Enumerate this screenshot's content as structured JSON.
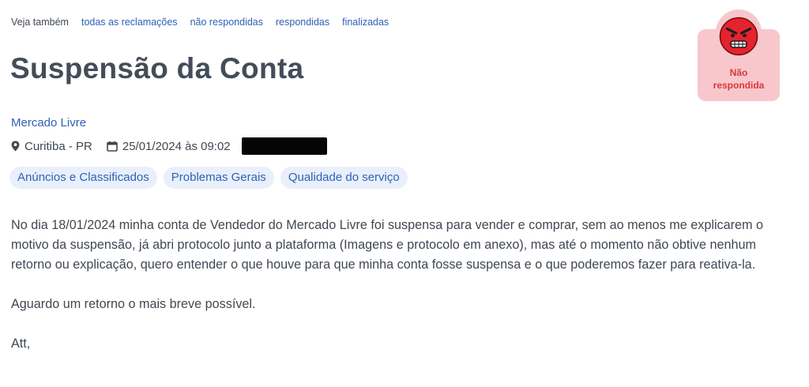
{
  "see_also": {
    "label": "Veja também",
    "links": [
      "todas as reclamações",
      "não respondidas",
      "respondidas",
      "finalizadas"
    ]
  },
  "complaint": {
    "title": "Suspensão da Conta",
    "company": "Mercado Livre",
    "location": "Curitiba - PR",
    "datetime": "25/01/2024 às 09:02",
    "tags": [
      "Anúncios e Classificados",
      "Problemas Gerais",
      "Qualidade do serviço"
    ],
    "paragraphs": [
      "No dia 18/01/2024 minha conta de Vendedor do Mercado Livre foi suspensa para vender e comprar, sem ao menos me explicarem o motivo da suspensão, já abri protocolo junto a plataforma (Imagens e protocolo em anexo), mas até o momento não obtive nenhum retorno ou explicação, quero entender o que houve para que minha conta fosse suspensa e o que poderemos fazer para reativa-la.",
      "Aguardo um retorno o mais breve possível.",
      "Att,"
    ]
  },
  "status": {
    "line1": "Não",
    "line2": "respondida",
    "icon": "angry-face-icon",
    "card_color": "#f7c7cb",
    "text_color": "#d9363e",
    "face_color": "#e5232d"
  },
  "colors": {
    "link": "#2f61b6",
    "text": "#3f4852",
    "title": "#434d59",
    "tag_bg": "#e9f0fb"
  },
  "icons": {
    "location": "map-pin-icon",
    "date": "calendar-icon"
  }
}
